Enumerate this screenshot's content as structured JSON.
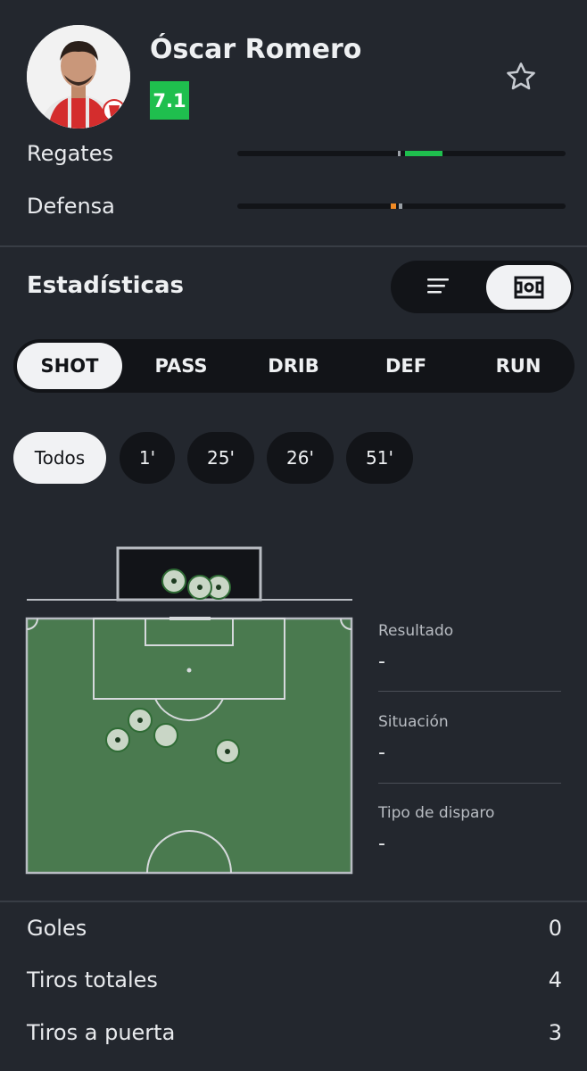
{
  "player": {
    "name": "Óscar Romero",
    "rating": "7.1",
    "rating_color": "#1fbf4e",
    "favorite_icon": "star-outline-icon"
  },
  "attributes": [
    {
      "label": "Regates"
    },
    {
      "label": "Defensa"
    }
  ],
  "statistics": {
    "title": "Estadísticas",
    "view_toggle": {
      "options": [
        "list-icon",
        "pitch-icon"
      ],
      "selected": "pitch-icon"
    },
    "type_tabs": [
      "SHOT",
      "PASS",
      "DRIB",
      "DEF",
      "RUN"
    ],
    "type_tab_selected": "SHOT",
    "time_chips": [
      "Todos",
      "1'",
      "25'",
      "26'",
      "51'"
    ],
    "time_chip_selected": "Todos"
  },
  "shot_detail": {
    "result_label": "Resultado",
    "result_value": "-",
    "situation_label": "Situación",
    "situation_value": "-",
    "shot_type_label": "Tipo de disparo",
    "shot_type_value": "-"
  },
  "summary": [
    {
      "label": "Goles",
      "value": "0"
    },
    {
      "label": "Tiros totales",
      "value": "4"
    },
    {
      "label": "Tiros a puerta",
      "value": "3"
    }
  ],
  "colors": {
    "background": "#23272e",
    "pitch": "#4a7a4f",
    "accent_green": "#1fbf4e",
    "accent_orange": "#f08a24"
  }
}
